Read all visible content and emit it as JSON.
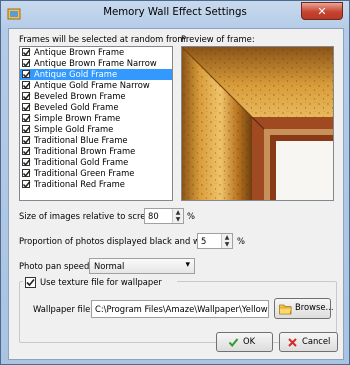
{
  "window": {
    "title": "Memory Wall Effect Settings",
    "close_glyph": "✕"
  },
  "frames": {
    "label": "Frames will be selected at random from:",
    "items": [
      {
        "label": "Antique Brown Frame",
        "checked": true,
        "selected": false
      },
      {
        "label": "Antique Brown Frame Narrow",
        "checked": true,
        "selected": false
      },
      {
        "label": "Antique Gold Frame",
        "checked": true,
        "selected": true
      },
      {
        "label": "Antique Gold Frame Narrow",
        "checked": true,
        "selected": false
      },
      {
        "label": "Beveled Brown Frame",
        "checked": true,
        "selected": false
      },
      {
        "label": "Beveled Gold Frame",
        "checked": true,
        "selected": false
      },
      {
        "label": "Simple Brown Frame",
        "checked": true,
        "selected": false
      },
      {
        "label": "Simple Gold Frame",
        "checked": true,
        "selected": false
      },
      {
        "label": "Traditional Blue Frame",
        "checked": true,
        "selected": false
      },
      {
        "label": "Traditional Brown Frame",
        "checked": true,
        "selected": false
      },
      {
        "label": "Traditional Gold Frame",
        "checked": true,
        "selected": false
      },
      {
        "label": "Traditional Green Frame",
        "checked": true,
        "selected": false
      },
      {
        "label": "Traditional Red Frame",
        "checked": true,
        "selected": false
      }
    ]
  },
  "preview": {
    "label": "Preview of frame:"
  },
  "image_size": {
    "label": "Size of images relative to screen:",
    "value": "80",
    "unit": "%"
  },
  "bw_proportion": {
    "label": "Proportion of photos displayed black and white:",
    "value": "5",
    "unit": "%"
  },
  "pan_speed": {
    "label": "Photo pan speed:",
    "value": "Normal"
  },
  "texture": {
    "checkbox_label": "Use texture file for wallpaper",
    "checked": true,
    "wallpaper_label": "Wallpaper file:",
    "wallpaper_path": "C:\\Program Files\\Amaze\\Wallpaper\\Yellow Shad",
    "browse_label": "Browse..."
  },
  "buttons": {
    "ok_label": "OK",
    "cancel_label": "Cancel"
  },
  "colors": {
    "selection": "#3399ff",
    "frame_gold": "#c98a2a",
    "ok_check": "#2f9a2f",
    "cancel_x": "#d32b2b"
  }
}
